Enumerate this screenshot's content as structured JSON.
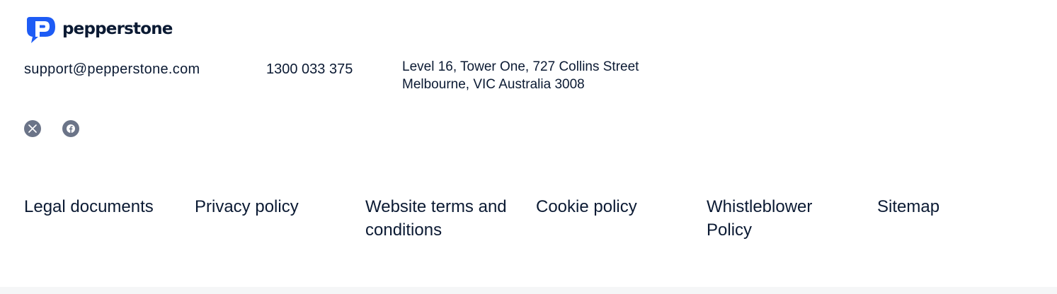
{
  "brand": {
    "name": "pepperstone",
    "logo_color": "#1e5cf5"
  },
  "contact": {
    "email": "support@pepperstone.com",
    "phone": "1300 033 375",
    "address_line1": "Level 16, Tower One, 727 Collins Street",
    "address_line2": "Melbourne, VIC Australia 3008"
  },
  "social": {
    "icons": [
      "x-icon",
      "facebook-icon"
    ],
    "icon_color": "#6b7488"
  },
  "footer_links": {
    "legal": "Legal documents",
    "privacy": "Privacy policy",
    "terms": "Website terms and conditions",
    "cookie": "Cookie policy",
    "whistleblower": "Whistleblower Policy",
    "sitemap": "Sitemap"
  },
  "colors": {
    "text": "#0b1a33",
    "background": "#ffffff"
  }
}
